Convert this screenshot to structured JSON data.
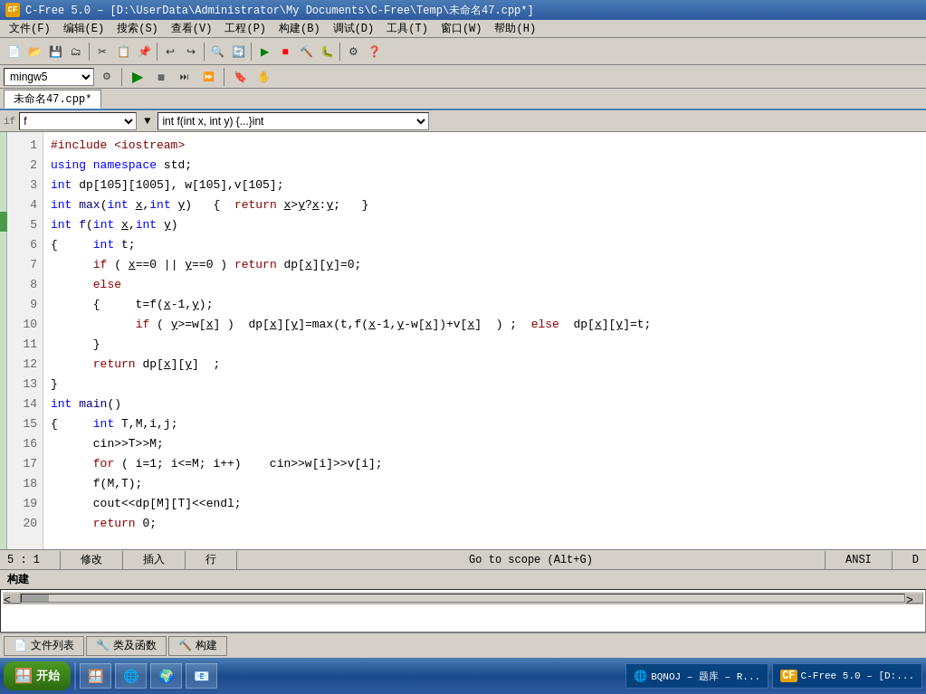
{
  "titlebar": {
    "text": "C-Free 5.0 – [D:\\UserData\\Administrator\\My Documents\\C-Free\\Temp\\未命名47.cpp*]",
    "icon": "CF"
  },
  "menubar": {
    "items": [
      "文件(F)",
      "编辑(E)",
      "搜索(S)",
      "查看(V)",
      "工程(P)",
      "构建(B)",
      "调试(D)",
      "工具(T)",
      "窗口(W)",
      "帮助(H)"
    ]
  },
  "toolbar2": {
    "compiler": "mingw5"
  },
  "tab": {
    "label": "未命名47.cpp*"
  },
  "funcbar": {
    "scope_label": "▼ f",
    "func_label": "▼ int f(int x, int y) {...}int"
  },
  "code": {
    "lines": [
      {
        "num": "1",
        "content": "#include <iostream>"
      },
      {
        "num": "2",
        "content": "using namespace std;"
      },
      {
        "num": "3",
        "content": "int dp[105][1005], w[105],v[105];"
      },
      {
        "num": "4",
        "content": "int max(int x,int y)   {  return x>y?x:y;   }"
      },
      {
        "num": "5",
        "content": "int f(int x,int y)"
      },
      {
        "num": "6",
        "content": "{     int t;"
      },
      {
        "num": "7",
        "content": "      if ( x==0 || y==0 ) return dp[x][y]=0;"
      },
      {
        "num": "8",
        "content": "      else"
      },
      {
        "num": "9",
        "content": "      {     t=f(x-1,y);"
      },
      {
        "num": "10",
        "content": "            if ( y>=w[x] )  dp[x][y]=max(t,f(x-1,y-w[x])+v[x]  ) ;  else  dp[x][y]=t;"
      },
      {
        "num": "11",
        "content": "      }"
      },
      {
        "num": "12",
        "content": "      return dp[x][y]  ;"
      },
      {
        "num": "13",
        "content": "}"
      },
      {
        "num": "14",
        "content": "int main()"
      },
      {
        "num": "15",
        "content": "{     int T,M,i,j;"
      },
      {
        "num": "16",
        "content": "      cin>>T>>M;"
      },
      {
        "num": "17",
        "content": "      for ( i=1; i<=M; i++)    cin>>w[i]>>v[i];"
      },
      {
        "num": "18",
        "content": "      f(M,T);"
      },
      {
        "num": "19",
        "content": "      cout<<dp[M][T]<<endl;"
      },
      {
        "num": "20",
        "content": "      return 0;"
      }
    ]
  },
  "statusbar": {
    "line": "5",
    "col": "1",
    "mode1": "修改",
    "mode2": "插入",
    "mode3": "行",
    "scope": "Go to scope (Alt+G)",
    "encoding": "ANSI",
    "extra": "D"
  },
  "build_panel": {
    "title": "构建"
  },
  "bottom_tabs": [
    {
      "icon": "📄",
      "label": "文件列表"
    },
    {
      "icon": "🔧",
      "label": "类及函数"
    },
    {
      "icon": "🔨",
      "label": "构建"
    }
  ],
  "taskbar": {
    "start": "开始",
    "apps": [
      {
        "label": "BQNOJ – 题库 – R...",
        "icon": "🌐"
      },
      {
        "label": "C-Free 5.0 – [D:...",
        "icon": "CF"
      }
    ]
  }
}
